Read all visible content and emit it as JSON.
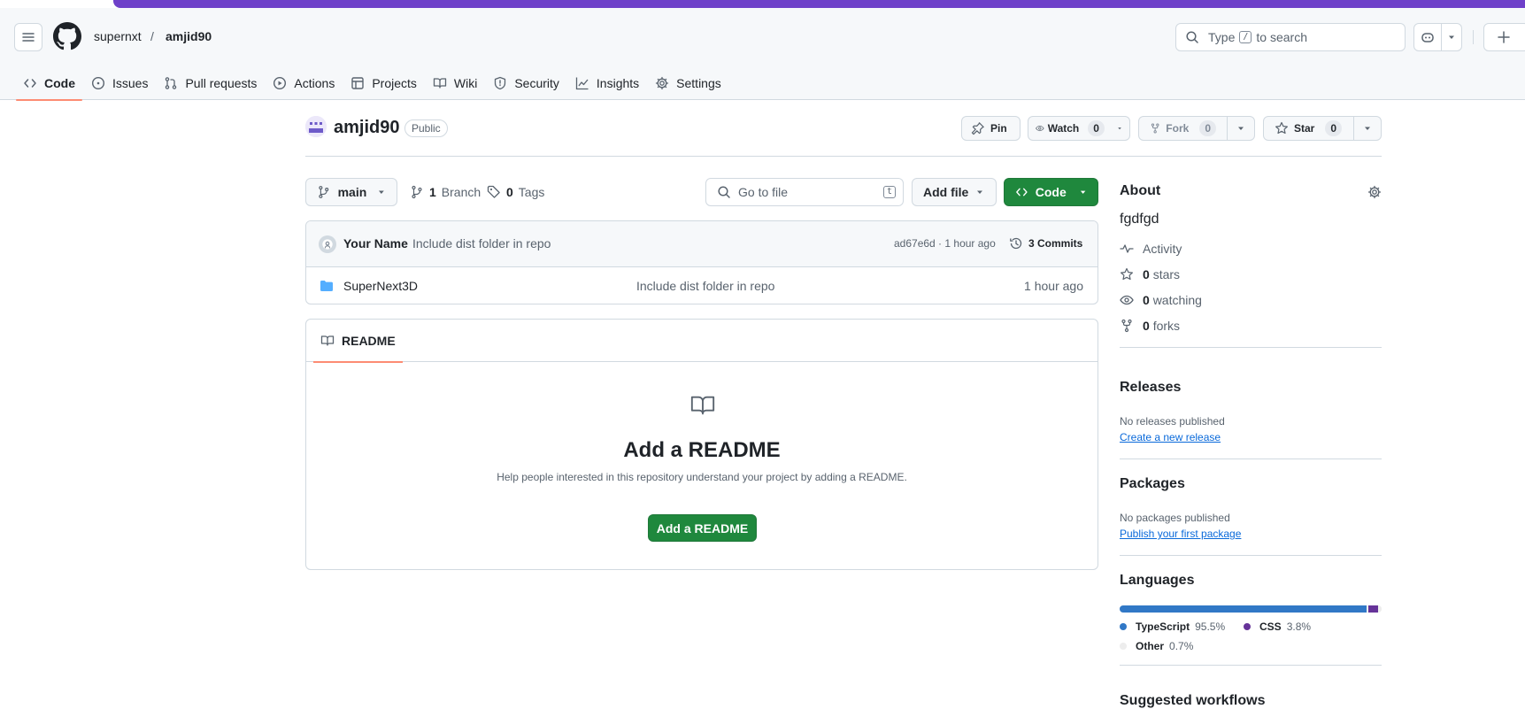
{
  "header": {
    "owner": "supernxt",
    "separator": "/",
    "repo": "amjid90",
    "search_before": "Type",
    "search_key": "/",
    "search_after": "to search"
  },
  "nav": {
    "tabs": [
      {
        "label": "Code",
        "icon": "code-icon",
        "active": true
      },
      {
        "label": "Issues",
        "icon": "issue-icon"
      },
      {
        "label": "Pull requests",
        "icon": "pull-request-icon"
      },
      {
        "label": "Actions",
        "icon": "play-icon"
      },
      {
        "label": "Projects",
        "icon": "table-icon"
      },
      {
        "label": "Wiki",
        "icon": "book-icon"
      },
      {
        "label": "Security",
        "icon": "shield-icon"
      },
      {
        "label": "Insights",
        "icon": "graph-icon"
      },
      {
        "label": "Settings",
        "icon": "gear-icon"
      }
    ]
  },
  "repo": {
    "name": "amjid90",
    "visibility": "Public",
    "pin_label": "Pin",
    "watch_label": "Watch",
    "watch_count": "0",
    "fork_label": "Fork",
    "fork_count": "0",
    "star_label": "Star",
    "star_count": "0"
  },
  "toolbar": {
    "branch": "main",
    "branch_count": "1",
    "branch_label": "Branch",
    "tag_count": "0",
    "tag_label": "Tags",
    "goto_placeholder": "Go to file",
    "goto_key": "t",
    "add_file": "Add file",
    "code": "Code"
  },
  "commit": {
    "author": "Your Name",
    "message": "Include dist folder in repo",
    "sha_time": "ad67e6d · 1 hour ago",
    "commits_label": "3 Commits"
  },
  "files": [
    {
      "name": "SuperNext3D",
      "message": "Include dist folder in repo",
      "time": "1 hour ago",
      "icon": "folder-icon"
    }
  ],
  "readme": {
    "tab": "README",
    "title": "Add a README",
    "description": "Help people interested in this repository understand your project by adding a README.",
    "button": "Add a README"
  },
  "about": {
    "heading": "About",
    "description": "fgdfgd",
    "activity": "Activity",
    "stars_count": "0",
    "stars_label": "stars",
    "watching_count": "0",
    "watching_label": "watching",
    "forks_count": "0",
    "forks_label": "forks"
  },
  "releases": {
    "heading": "Releases",
    "none": "No releases published",
    "link": "Create a new release"
  },
  "packages": {
    "heading": "Packages",
    "none": "No packages published",
    "link": "Publish your first package"
  },
  "languages": {
    "heading": "Languages",
    "items": [
      {
        "name": "TypeScript",
        "percent": "95.5%",
        "value": 95.5,
        "color": "#3178c6"
      },
      {
        "name": "CSS",
        "percent": "3.8%",
        "value": 3.8,
        "color": "#663399"
      },
      {
        "name": "Other",
        "percent": "0.7%",
        "value": 0.7,
        "color": "#ededed"
      }
    ]
  },
  "suggested": {
    "heading": "Suggested workflows"
  },
  "colors": {
    "accent_purple": "#6e40c9",
    "primary_green": "#1f883d",
    "link_blue": "#0969da",
    "tab_underline": "#fd8c73"
  }
}
